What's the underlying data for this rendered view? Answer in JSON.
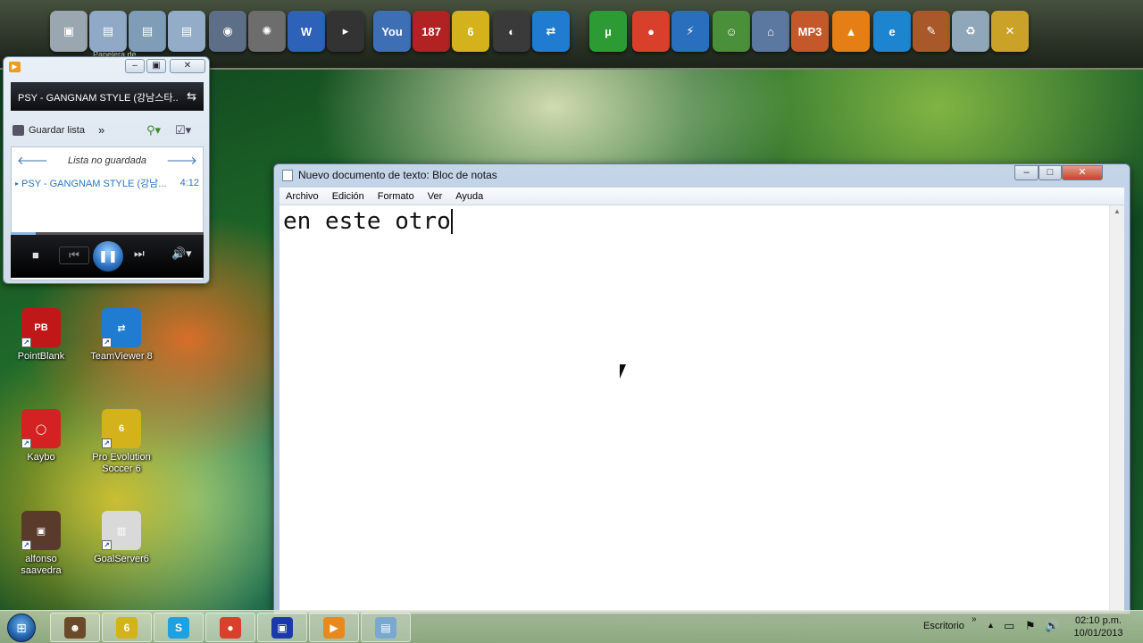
{
  "dock": {
    "apps": [
      {
        "name": "computer",
        "glyph": "▣",
        "color": "#9aa6b0"
      },
      {
        "name": "folder-1",
        "glyph": "▤",
        "color": "#8fa9c7"
      },
      {
        "name": "folder-2",
        "glyph": "▤",
        "color": "#7f9db7"
      },
      {
        "name": "folder-3",
        "glyph": "▤",
        "color": "#93adc8"
      },
      {
        "name": "media-disc",
        "glyph": "◉",
        "color": "#5d6f86"
      },
      {
        "name": "film-reel",
        "glyph": "✺",
        "color": "#6d6d6d"
      },
      {
        "name": "word",
        "glyph": "W",
        "color": "#2d62b8"
      },
      {
        "name": "terminal",
        "glyph": "▸",
        "color": "#333"
      },
      {
        "name": "youtube",
        "glyph": "You",
        "color": "#3e6fb5"
      },
      {
        "name": "district-187",
        "glyph": "187",
        "color": "#b22222"
      },
      {
        "name": "pes",
        "glyph": "6",
        "color": "#d4b21c"
      },
      {
        "name": "garena",
        "glyph": "◐",
        "color": "#3a3a3a"
      },
      {
        "name": "teamviewer",
        "glyph": "⇄",
        "color": "#1f7cd0"
      },
      {
        "name": "utorrent",
        "glyph": "µ",
        "color": "#2c9b34"
      },
      {
        "name": "chrome",
        "glyph": "●",
        "color": "#d9402c"
      },
      {
        "name": "speed",
        "glyph": "⚡",
        "color": "#2a6fbd"
      },
      {
        "name": "messenger",
        "glyph": "☺",
        "color": "#4a8f3a"
      },
      {
        "name": "network",
        "glyph": "⌂",
        "color": "#5a78a0"
      },
      {
        "name": "mp3",
        "glyph": "MP3",
        "color": "#c4582a"
      },
      {
        "name": "vlc",
        "glyph": "▲",
        "color": "#e67e16"
      },
      {
        "name": "ie",
        "glyph": "e",
        "color": "#1d84cf"
      },
      {
        "name": "tool",
        "glyph": "✎",
        "color": "#a9582a"
      },
      {
        "name": "recycle-bin",
        "glyph": "♻",
        "color": "#8fa7b8"
      },
      {
        "name": "wrench",
        "glyph": "✕",
        "color": "#c9a227"
      }
    ],
    "sublabel": "Papelera de"
  },
  "media_player": {
    "now_playing": "PSY - GANGNAM STYLE (강남스타...",
    "save_list": "Guardar lista",
    "more": "»",
    "list_title": "Lista no guardada",
    "track_title": "PSY - GANGNAM STYLE (강남...",
    "track_time": "4:12",
    "seek_progress": 0.13
  },
  "desktop_icons": [
    {
      "label": "PointBlank",
      "glyph": "PB",
      "color": "#c01818"
    },
    {
      "label": "TeamViewer 8",
      "glyph": "⇄",
      "color": "#1f7cd0"
    },
    {
      "label": "Kaybo",
      "glyph": "◯",
      "color": "#d42222"
    },
    {
      "label": "Pro Evolution Soccer 6",
      "glyph": "6",
      "color": "#d4b21c"
    },
    {
      "label": "alfonso saavedra",
      "glyph": "▣",
      "color": "#5a3a2a"
    },
    {
      "label": "GoalServer6",
      "glyph": "▥",
      "color": "#d9d9d9"
    }
  ],
  "notepad": {
    "title": "Nuevo documento de texto: Bloc de notas",
    "menu": [
      "Archivo",
      "Edición",
      "Formato",
      "Ver",
      "Ayuda"
    ],
    "content": "en este otro",
    "minimize": "–",
    "maximize": "□",
    "close": "✕"
  },
  "taskbar": {
    "items": [
      {
        "name": "character",
        "glyph": "☻",
        "color": "#6b4a2a"
      },
      {
        "name": "pes",
        "glyph": "6",
        "color": "#d4b21c"
      },
      {
        "name": "skype",
        "glyph": "S",
        "color": "#1fa0e0"
      },
      {
        "name": "chrome",
        "glyph": "●",
        "color": "#d9402c"
      },
      {
        "name": "pinnacle",
        "glyph": "▣",
        "color": "#1a3aa8"
      },
      {
        "name": "media-player",
        "glyph": "▶",
        "color": "#e8891e"
      },
      {
        "name": "notepad",
        "glyph": "▤",
        "color": "#7aa8d0"
      }
    ],
    "desktop_label": "Escritorio",
    "chevron": "»",
    "time": "02:10 p.m.",
    "date": "10/01/2013"
  }
}
